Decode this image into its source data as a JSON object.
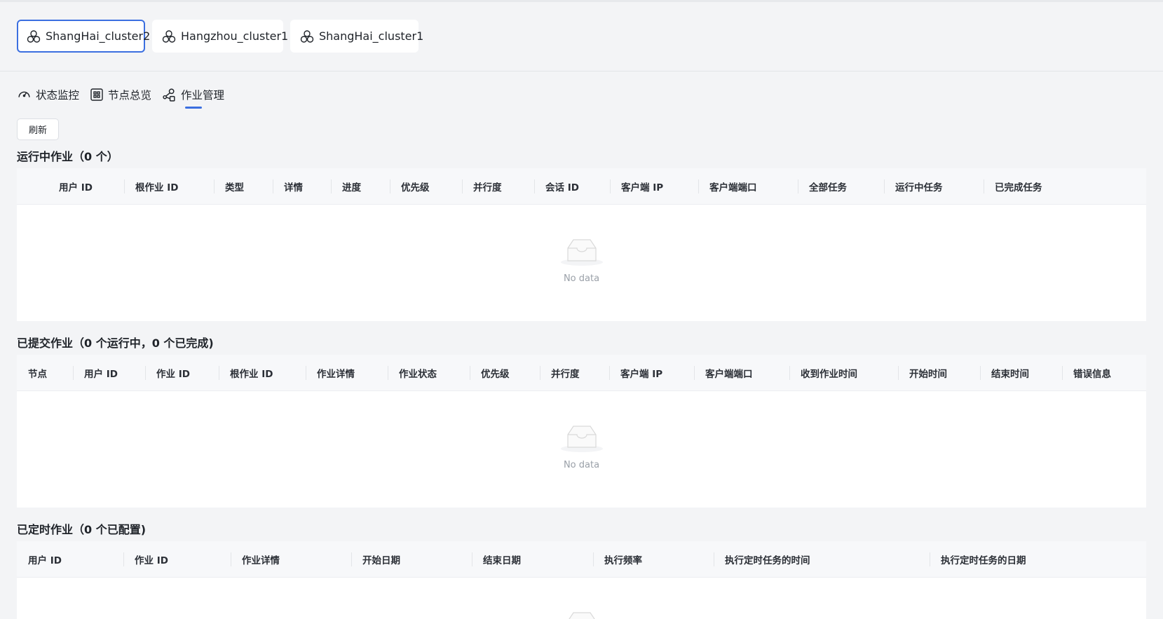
{
  "clusters": [
    {
      "label": "ShangHai_cluster2",
      "active": true
    },
    {
      "label": "Hangzhou_cluster1",
      "active": false
    },
    {
      "label": "ShangHai_cluster1",
      "active": false
    }
  ],
  "nav": {
    "tabs": [
      {
        "label": "状态监控",
        "icon": "gauge-icon"
      },
      {
        "label": "节点总览",
        "icon": "grid-icon"
      },
      {
        "label": "作业管理",
        "icon": "job-icon",
        "active": true
      }
    ]
  },
  "toolbar": {
    "refresh_label": "刷新"
  },
  "colors": {
    "accent": "#3b6fe0",
    "header_bg": "#f7f8fa",
    "page_bg": "#f3f4f6"
  },
  "running_jobs": {
    "title": "运行中作业（0 个）",
    "columns": [
      "用户 ID",
      "根作业 ID",
      "类型",
      "详情",
      "进度",
      "优先级",
      "并行度",
      "会话 ID",
      "客户端 IP",
      "客户端端口",
      "全部任务",
      "运行中任务",
      "已完成任务"
    ],
    "rows": [],
    "empty_text": "No data"
  },
  "submitted_jobs": {
    "title": "已提交作业（0 个运行中，0 个已完成)",
    "columns": [
      "节点",
      "用户 ID",
      "作业 ID",
      "根作业 ID",
      "作业详情",
      "作业状态",
      "优先级",
      "并行度",
      "客户端 IP",
      "客户端端口",
      "收到作业时间",
      "开始时间",
      "结束时间",
      "错误信息"
    ],
    "rows": [],
    "empty_text": "No data"
  },
  "scheduled_jobs": {
    "title": "已定时作业（0 个已配置)",
    "columns": [
      "用户 ID",
      "作业 ID",
      "作业详情",
      "开始日期",
      "结束日期",
      "执行频率",
      "执行定时任务的时间",
      "执行定时任务的日期"
    ],
    "rows": []
  }
}
